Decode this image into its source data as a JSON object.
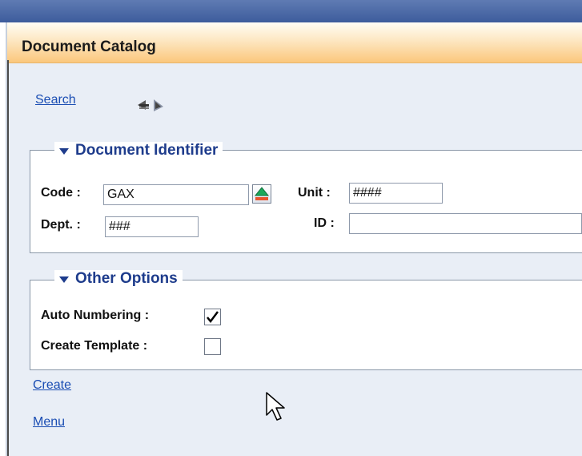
{
  "header": {
    "title": "Document Catalog"
  },
  "toolbar": {
    "search_label": "Search",
    "nav_icons": [
      "previous-arrow-icon",
      "next-arrow-icon"
    ]
  },
  "document_identifier": {
    "legend": "Document Identifier",
    "code": {
      "label": "Code :",
      "value": "GAX"
    },
    "dept": {
      "label": "Dept. :",
      "value": "###"
    },
    "unit": {
      "label": "Unit :",
      "value": "####"
    },
    "id": {
      "label": "ID :",
      "value": ""
    },
    "lookup_icon": "lookup-icon"
  },
  "other_options": {
    "legend": "Other Options",
    "auto_numbering": {
      "label": "Auto Numbering :",
      "checked": true
    },
    "create_template": {
      "label": "Create Template :",
      "checked": false
    }
  },
  "links": {
    "create": "Create",
    "menu": "Menu"
  },
  "colors": {
    "link": "#1a4db3",
    "legend": "#1e3c8c",
    "title_gradient_end": "#fbc77c"
  }
}
